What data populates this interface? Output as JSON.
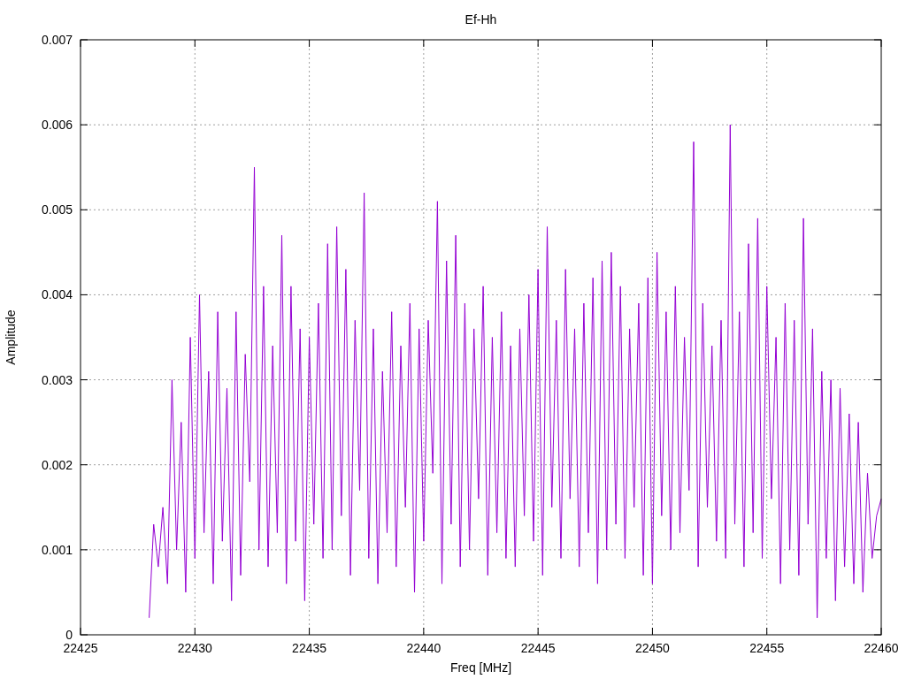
{
  "chart_data": {
    "type": "line",
    "title": "Ef-Hh",
    "xlabel": "Freq [MHz]",
    "ylabel": "Amplitude",
    "grid": true,
    "xlim": [
      22425,
      22460
    ],
    "ylim": [
      0,
      0.007
    ],
    "xticks": [
      {
        "value": 22425,
        "label": "22425"
      },
      {
        "value": 22430,
        "label": "22430"
      },
      {
        "value": 22435,
        "label": "22435"
      },
      {
        "value": 22440,
        "label": "22440"
      },
      {
        "value": 22445,
        "label": "22445"
      },
      {
        "value": 22450,
        "label": "22450"
      },
      {
        "value": 22455,
        "label": "22455"
      },
      {
        "value": 22460,
        "label": "22460"
      }
    ],
    "yticks": [
      {
        "value": 0,
        "label": "0"
      },
      {
        "value": 0.001,
        "label": "0.001"
      },
      {
        "value": 0.002,
        "label": "0.002"
      },
      {
        "value": 0.003,
        "label": "0.003"
      },
      {
        "value": 0.004,
        "label": "0.004"
      },
      {
        "value": 0.005,
        "label": "0.005"
      },
      {
        "value": 0.006,
        "label": "0.006"
      },
      {
        "value": 0.007,
        "label": "0.007"
      }
    ],
    "x": [
      22428.0,
      22428.2,
      22428.4,
      22428.6,
      22428.8,
      22429.0,
      22429.2,
      22429.4,
      22429.6,
      22429.8,
      22430.0,
      22430.2,
      22430.4,
      22430.6,
      22430.8,
      22431.0,
      22431.2,
      22431.4,
      22431.6,
      22431.8,
      22432.0,
      22432.2,
      22432.4,
      22432.6,
      22432.8,
      22433.0,
      22433.2,
      22433.4,
      22433.6,
      22433.8,
      22434.0,
      22434.2,
      22434.4,
      22434.6,
      22434.8,
      22435.0,
      22435.2,
      22435.4,
      22435.6,
      22435.8,
      22436.0,
      22436.2,
      22436.4,
      22436.6,
      22436.8,
      22437.0,
      22437.2,
      22437.4,
      22437.6,
      22437.8,
      22438.0,
      22438.2,
      22438.4,
      22438.6,
      22438.8,
      22439.0,
      22439.2,
      22439.4,
      22439.6,
      22439.8,
      22440.0,
      22440.2,
      22440.4,
      22440.6,
      22440.8,
      22441.0,
      22441.2,
      22441.4,
      22441.6,
      22441.8,
      22442.0,
      22442.2,
      22442.4,
      22442.6,
      22442.8,
      22443.0,
      22443.2,
      22443.4,
      22443.6,
      22443.8,
      22444.0,
      22444.2,
      22444.4,
      22444.6,
      22444.8,
      22445.0,
      22445.2,
      22445.4,
      22445.6,
      22445.8,
      22446.0,
      22446.2,
      22446.4,
      22446.6,
      22446.8,
      22447.0,
      22447.2,
      22447.4,
      22447.6,
      22447.8,
      22448.0,
      22448.2,
      22448.4,
      22448.6,
      22448.8,
      22449.0,
      22449.2,
      22449.4,
      22449.6,
      22449.8,
      22450.0,
      22450.2,
      22450.4,
      22450.6,
      22450.8,
      22451.0,
      22451.2,
      22451.4,
      22451.6,
      22451.8,
      22452.0,
      22452.2,
      22452.4,
      22452.6,
      22452.8,
      22453.0,
      22453.2,
      22453.4,
      22453.6,
      22453.8,
      22454.0,
      22454.2,
      22454.4,
      22454.6,
      22454.8,
      22455.0,
      22455.2,
      22455.4,
      22455.6,
      22455.8,
      22456.0,
      22456.2,
      22456.4,
      22456.6,
      22456.8,
      22457.0,
      22457.2,
      22457.4,
      22457.6,
      22457.8,
      22458.0,
      22458.2,
      22458.4,
      22458.6,
      22458.8,
      22459.0,
      22459.2,
      22459.4,
      22459.6,
      22459.8,
      22460.0
    ],
    "series": [
      {
        "color": "#9400d3",
        "values": [
          0.0002,
          0.0013,
          0.0008,
          0.0015,
          0.0006,
          0.003,
          0.001,
          0.0025,
          0.0005,
          0.0035,
          0.0009,
          0.004,
          0.0012,
          0.0031,
          0.0006,
          0.0038,
          0.0011,
          0.0029,
          0.0004,
          0.0038,
          0.0007,
          0.0033,
          0.0018,
          0.0055,
          0.001,
          0.0041,
          0.0008,
          0.0034,
          0.0012,
          0.0047,
          0.0006,
          0.0041,
          0.0011,
          0.0036,
          0.0004,
          0.0035,
          0.0013,
          0.0039,
          0.0009,
          0.0046,
          0.001,
          0.0048,
          0.0014,
          0.0043,
          0.0007,
          0.0037,
          0.0017,
          0.0052,
          0.0009,
          0.0036,
          0.0006,
          0.0031,
          0.0012,
          0.0038,
          0.0008,
          0.0034,
          0.0015,
          0.0039,
          0.0005,
          0.0036,
          0.0011,
          0.0037,
          0.0019,
          0.0051,
          0.0006,
          0.0044,
          0.0013,
          0.0047,
          0.0008,
          0.0039,
          0.001,
          0.0036,
          0.0016,
          0.0041,
          0.0007,
          0.0035,
          0.0012,
          0.0038,
          0.0009,
          0.0034,
          0.0008,
          0.0036,
          0.0014,
          0.004,
          0.0011,
          0.0043,
          0.0007,
          0.0048,
          0.0015,
          0.0037,
          0.0009,
          0.0043,
          0.0016,
          0.0036,
          0.0008,
          0.0039,
          0.0012,
          0.0042,
          0.0006,
          0.0044,
          0.001,
          0.0045,
          0.0013,
          0.0041,
          0.0009,
          0.0036,
          0.0015,
          0.0039,
          0.0007,
          0.0042,
          0.0006,
          0.0045,
          0.0014,
          0.0038,
          0.001,
          0.0041,
          0.0012,
          0.0035,
          0.0017,
          0.0058,
          0.0008,
          0.0039,
          0.0015,
          0.0034,
          0.0011,
          0.0037,
          0.0009,
          0.006,
          0.0013,
          0.0038,
          0.0008,
          0.0046,
          0.0012,
          0.0049,
          0.0009,
          0.0041,
          0.0016,
          0.0035,
          0.0006,
          0.0039,
          0.001,
          0.0037,
          0.0007,
          0.0049,
          0.0013,
          0.0036,
          0.0002,
          0.0031,
          0.0009,
          0.003,
          0.0004,
          0.0029,
          0.0008,
          0.0026,
          0.0006,
          0.0025,
          0.0005,
          0.0019,
          0.0009,
          0.0014,
          0.0016
        ]
      }
    ]
  }
}
